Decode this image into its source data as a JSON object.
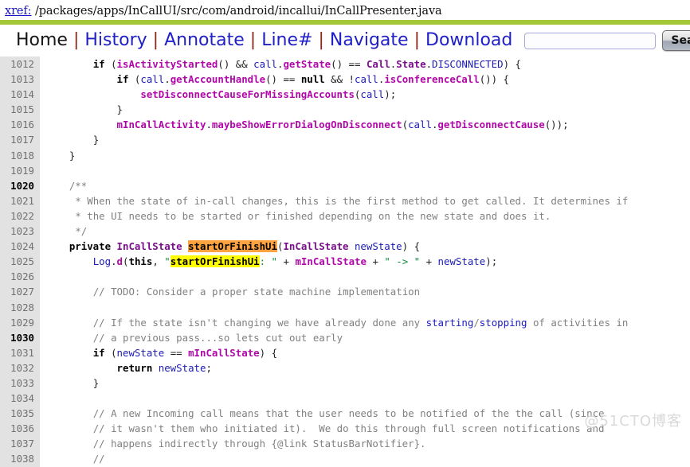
{
  "header": {
    "xref_label": "xref:",
    "file_path": "/packages/apps/InCallUI/src/com/android/incallui/InCallPresenter.java"
  },
  "nav": {
    "items": [
      {
        "label": "Home",
        "current": true
      },
      {
        "label": "History",
        "current": false
      },
      {
        "label": "Annotate",
        "current": false
      },
      {
        "label": "Line#",
        "current": false
      },
      {
        "label": "Navigate",
        "current": false
      },
      {
        "label": "Download",
        "current": false
      }
    ],
    "separator": "|",
    "search": {
      "value": "",
      "placeholder": ""
    },
    "search_button": "Search"
  },
  "colors": {
    "accent_green": "#a4c639",
    "link_blue": "#2020c8",
    "gutter_gray": "#e2e2e2",
    "highlight_orange": "#ffa340",
    "highlight_yellow": "#ffff00",
    "comment_gray": "#808080",
    "string_green": "#0f8a3c",
    "method_magenta": "#b008a8",
    "type_purple": "#7a0f8c"
  },
  "watermark": "@51CTO博客",
  "code": {
    "first_line": 1012,
    "highlighted_lines": [
      1020,
      1030
    ],
    "lines": [
      {
        "n": 1012,
        "raw": "        if (isActivityStarted() && call.getState() == Call.State.DISCONNECTED) {"
      },
      {
        "n": 1013,
        "raw": "            if (call.getAccountHandle() == null && !call.isConferenceCall()) {"
      },
      {
        "n": 1014,
        "raw": "                setDisconnectCauseForMissingAccounts(call);"
      },
      {
        "n": 1015,
        "raw": "            }"
      },
      {
        "n": 1016,
        "raw": "            mInCallActivity.maybeShowErrorDialogOnDisconnect(call.getDisconnectCause());"
      },
      {
        "n": 1017,
        "raw": "        }"
      },
      {
        "n": 1018,
        "raw": "    }"
      },
      {
        "n": 1019,
        "raw": ""
      },
      {
        "n": 1020,
        "raw": "    /**"
      },
      {
        "n": 1021,
        "raw": "     * When the state of in-call changes, this is the first method to get called. It determines if"
      },
      {
        "n": 1022,
        "raw": "     * the UI needs to be started or finished depending on the new state and does it."
      },
      {
        "n": 1023,
        "raw": "     */"
      },
      {
        "n": 1024,
        "raw": "    private InCallState startOrFinishUi(InCallState newState) {"
      },
      {
        "n": 1025,
        "raw": "        Log.d(this, \"startOrFinishUi: \" + mInCallState + \" -> \" + newState);"
      },
      {
        "n": 1026,
        "raw": ""
      },
      {
        "n": 1027,
        "raw": "        // TODO: Consider a proper state machine implementation"
      },
      {
        "n": 1028,
        "raw": ""
      },
      {
        "n": 1029,
        "raw": "        // If the state isn't changing we have already done any starting/stopping of activities in"
      },
      {
        "n": 1030,
        "raw": "        // a previous pass...so lets cut out early"
      },
      {
        "n": 1031,
        "raw": "        if (newState == mInCallState) {"
      },
      {
        "n": 1032,
        "raw": "            return newState;"
      },
      {
        "n": 1033,
        "raw": "        }"
      },
      {
        "n": 1034,
        "raw": ""
      },
      {
        "n": 1035,
        "raw": "        // A new Incoming call means that the user needs to be notified of the the call (since"
      },
      {
        "n": 1036,
        "raw": "        // it wasn't them who initiated it).  We do this through full screen notifications and"
      },
      {
        "n": 1037,
        "raw": "        // happens indirectly through {@link StatusBarNotifier}."
      },
      {
        "n": 1038,
        "raw": "        //"
      }
    ]
  }
}
